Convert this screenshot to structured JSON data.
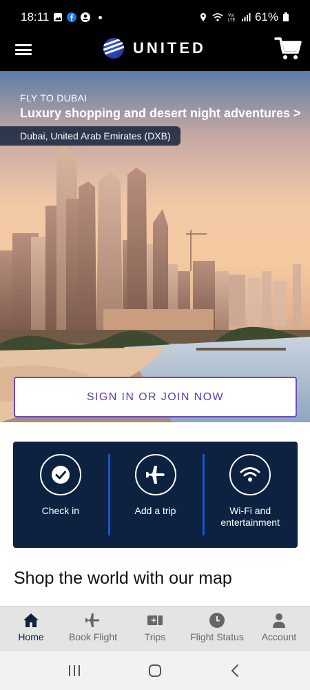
{
  "status_bar": {
    "time": "18:11",
    "battery": "61%"
  },
  "header": {
    "brand": "UNITED"
  },
  "hero": {
    "kicker": "FLY TO DUBAI",
    "headline": "Luxury shopping and desert night adventures >",
    "location": "Dubai, United Arab Emirates (DXB)",
    "signin_label": "SIGN IN OR JOIN NOW"
  },
  "quick_actions": [
    {
      "label": "Check in",
      "icon": "checkmark-icon"
    },
    {
      "label": "Add a trip",
      "icon": "airplane-icon"
    },
    {
      "label": "Wi-Fi and entertainment",
      "icon": "wifi-icon"
    }
  ],
  "section_title": "Shop the world with our map",
  "tabs": [
    {
      "label": "Home",
      "icon": "home-icon",
      "active": true
    },
    {
      "label": "Book Flight",
      "icon": "airplane-icon"
    },
    {
      "label": "Trips",
      "icon": "ticket-icon"
    },
    {
      "label": "Flight Status",
      "icon": "clock-icon"
    },
    {
      "label": "Account",
      "icon": "person-icon"
    }
  ],
  "colors": {
    "navy": "#0d2240",
    "accent_purple": "#6a4cc4",
    "divider_blue": "#1f4fd1"
  }
}
